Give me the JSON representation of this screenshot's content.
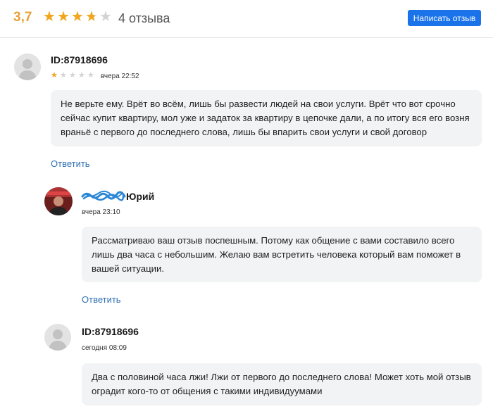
{
  "header": {
    "rating": "3,7",
    "rating_value": 3.7,
    "stars_max": 5,
    "review_count": "4 отзыва",
    "write_button": "Написать отзыв"
  },
  "reviews": [
    {
      "author": "ID:87918696",
      "stars": 1,
      "date": "вчера 22:52",
      "text": "Не верьте ему. Врёт во всём, лишь бы развести людей на свои услуги. Врёт что вот срочно сейчас купит квартиру, мол уже и задаток за квартиру в цепочке дали, а по итогу вся его возня враньё с первого до последнего слова, лишь бы впарить свои услуги и свой договор",
      "reply_label": "Ответить"
    },
    {
      "author": "Юрий",
      "date": "вчера 23:10",
      "text": "Рассматриваю ваш отзыв поспешным. Потому как общение с вами составило всего лишь два часа с небольшим. Желаю вам встретить человека который вам поможет в вашей ситуации.",
      "reply_label": "Ответить"
    },
    {
      "author": "ID:87918696",
      "date": "сегодня 08:09",
      "text": "Два с половиной часа лжи! Лжи от первого до последнего слова! Может хоть мой отзыв оградит кого-то от общения с такими индивидуумами"
    }
  ],
  "colors": {
    "accent": "#1a73e8",
    "rating": "#e8a23a",
    "star_filled": "#f2a71b",
    "star_empty": "#d3d3d3",
    "link": "#2f6fb3",
    "bubble": "#f2f3f5",
    "redaction": "#2b87d6"
  }
}
